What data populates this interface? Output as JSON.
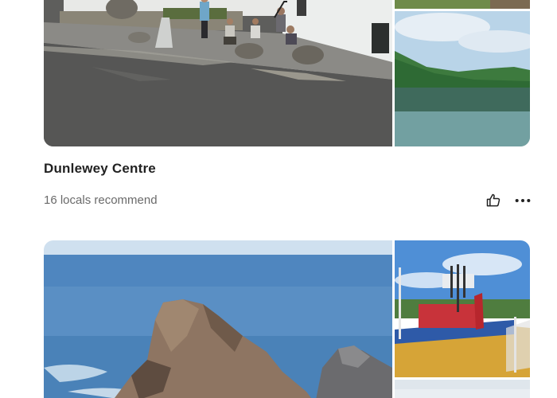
{
  "cards": [
    {
      "title": "Dunlewey Centre",
      "recommend": "16 locals recommend",
      "photos": [
        {
          "icon": "street-with-people-photo"
        },
        {
          "icon": "grass-photo"
        },
        {
          "icon": "lake-hills-photo"
        }
      ]
    },
    {
      "photos": [
        {
          "icon": "sea-rock-photo"
        },
        {
          "icon": "playground-photo"
        },
        {
          "icon": "sky-photo"
        }
      ]
    }
  ],
  "actions": {
    "like_icon": "thumbs-up-icon",
    "more_icon": "more-dots-icon"
  },
  "colors": {
    "title": "#222222",
    "secondary_text": "#6a6a6a"
  }
}
